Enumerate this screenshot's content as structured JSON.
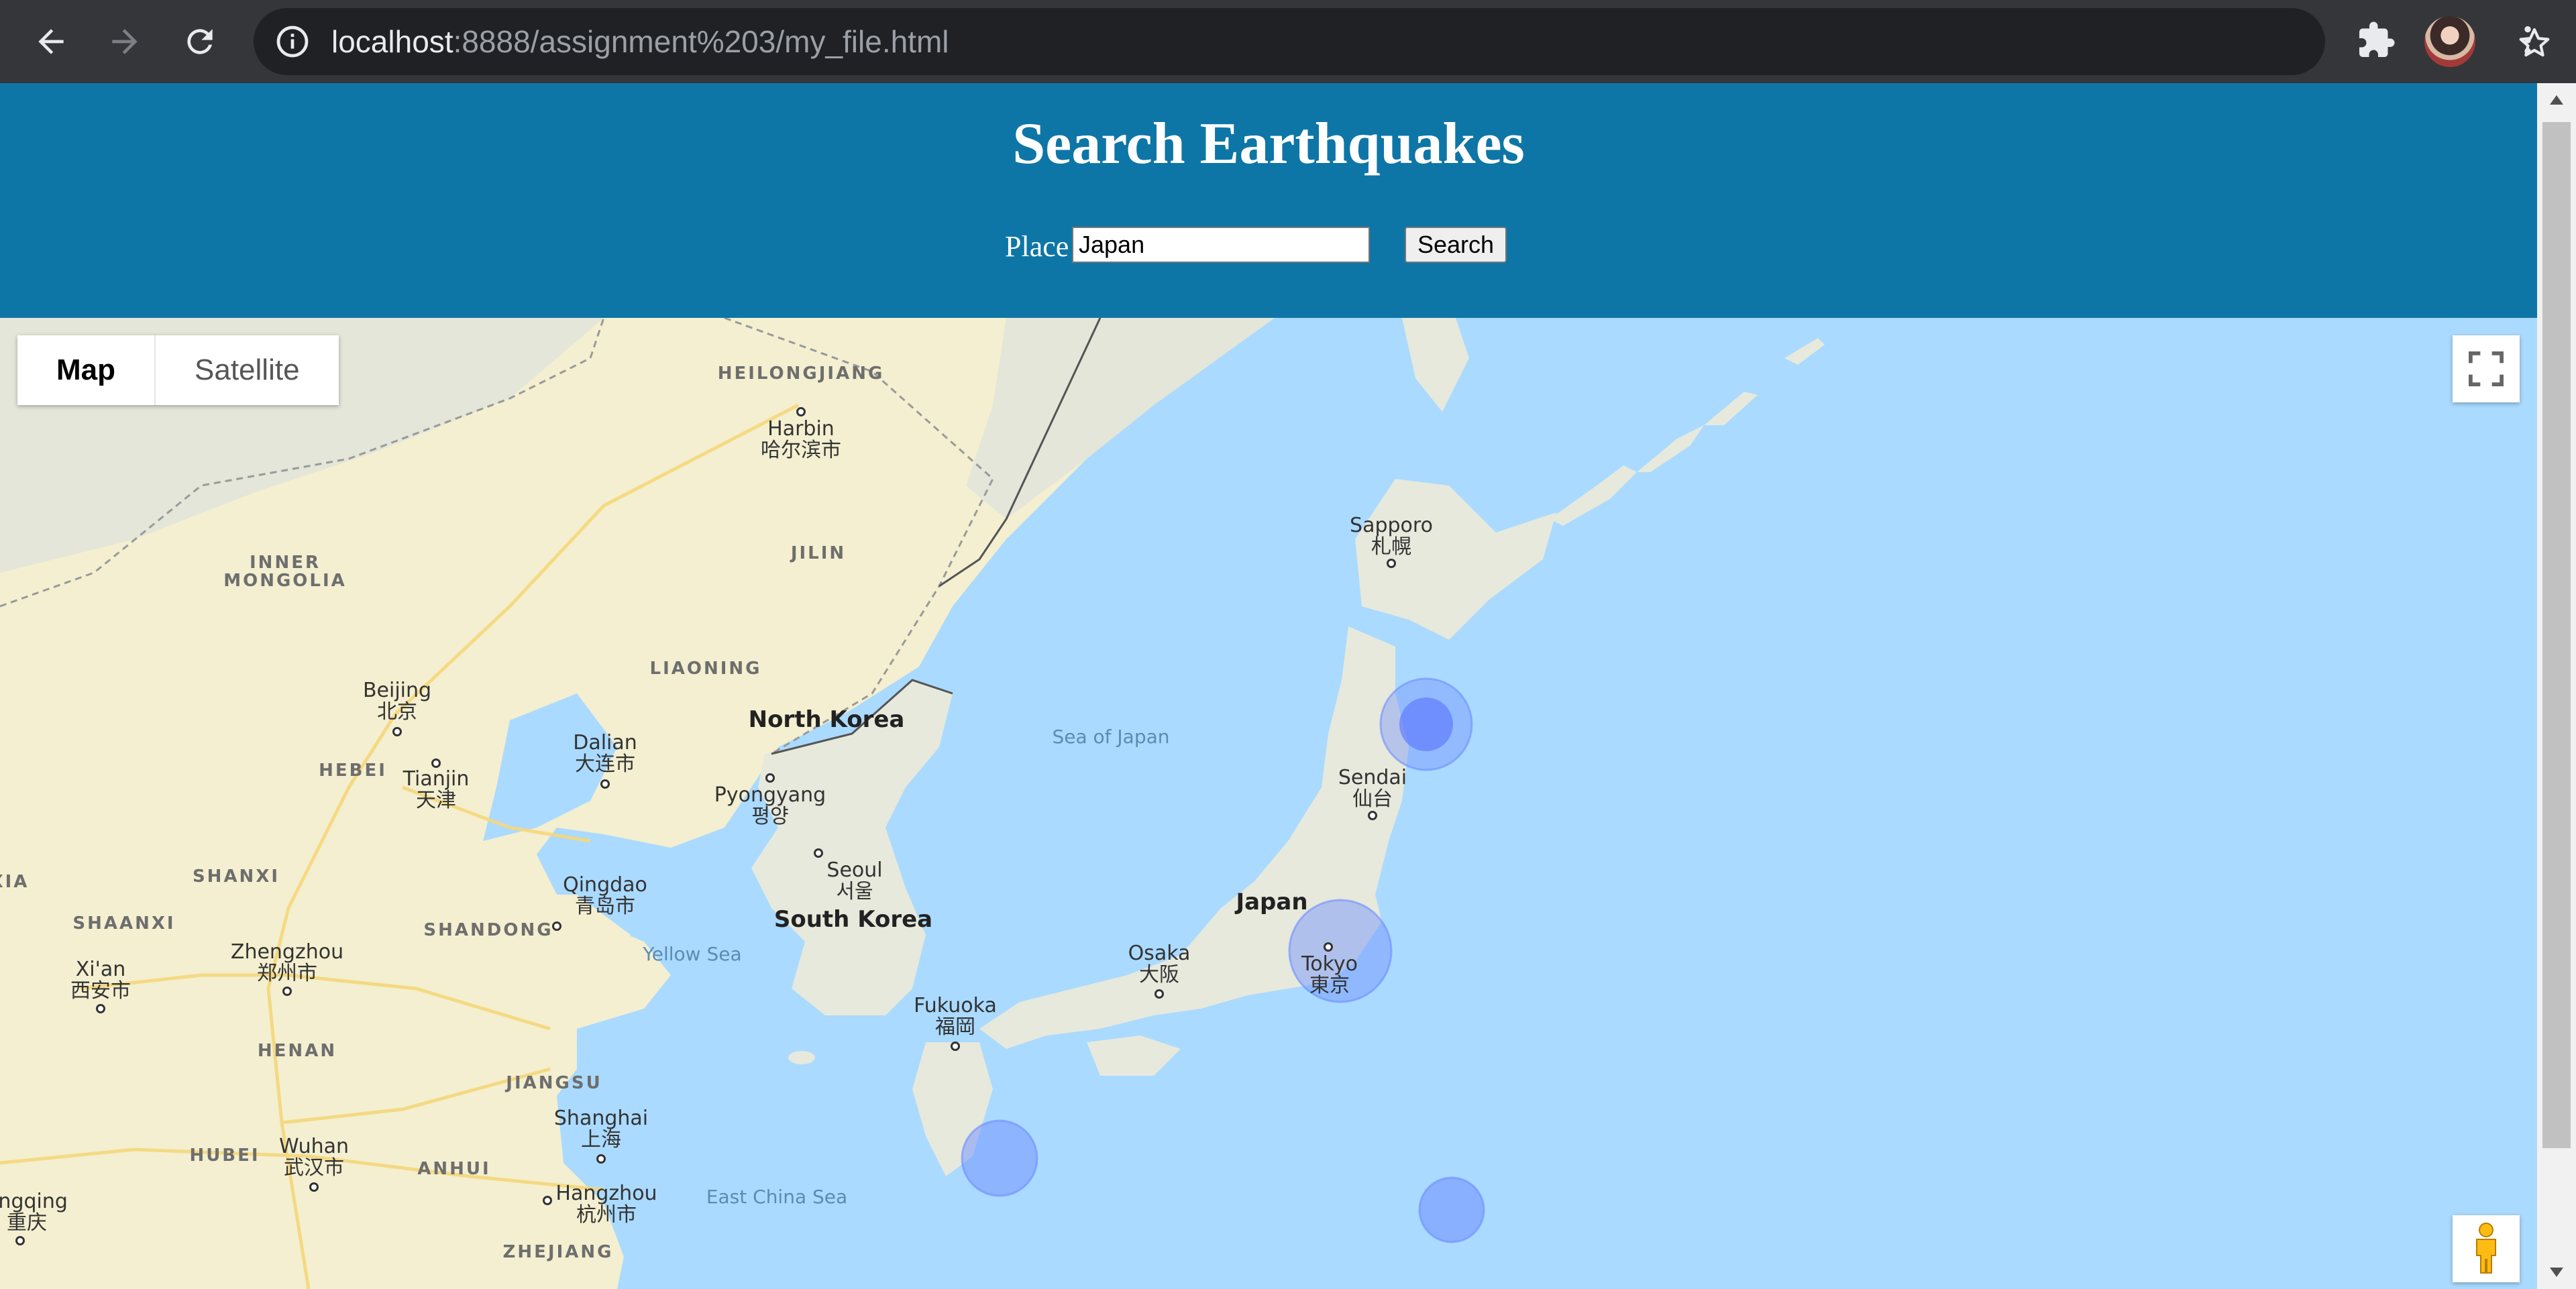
{
  "browser": {
    "url_host": "localhost",
    "url_rest": ":8888/assignment%203/my_file.html"
  },
  "page": {
    "title": "Search Earthquakes",
    "place_label": "Place",
    "place_value": "Japan",
    "search_label": "Search"
  },
  "map": {
    "type_controls": [
      "Map",
      "Satellite"
    ],
    "active_type": "Map",
    "labels": {
      "heilongjiang": "HEILONGJIANG",
      "harbin": "Harbin",
      "harbin_local": "哈尔滨市",
      "jilin": "JILIN",
      "inner_mongolia": "INNER\nMONGOLIA",
      "liaoning": "LIAONING",
      "beijing": "Beijing",
      "beijing_local": "北京",
      "hebei": "HEBEI",
      "tianjin": "Tianjin",
      "tianjin_local": "天津",
      "dalian": "Dalian",
      "dalian_local": "大连市",
      "north_korea": "North Korea",
      "pyongyang": "Pyongyang",
      "pyongyang_local": "평양",
      "seoul": "Seoul",
      "seoul_local": "서울",
      "south_korea": "South Korea",
      "sea_of_japan": "Sea of Japan",
      "sapporo": "Sapporo",
      "sapporo_local": "札幌",
      "sendai": "Sendai",
      "sendai_local": "仙台",
      "japan": "Japan",
      "tokyo": "Tokyo",
      "tokyo_local": "東京",
      "osaka": "Osaka",
      "osaka_local": "大阪",
      "fukuoka": "Fukuoka",
      "fukuoka_local": "福岡",
      "shanxi": "SHANXI",
      "shaanxi": "SHAANXI",
      "xian": "Xi'an",
      "xian_local": "西安市",
      "zhengzhou": "Zhengzhou",
      "zhengzhou_local": "郑州市",
      "shandong": "SHANDONG",
      "qingdao": "Qingdao",
      "qingdao_local": "青岛市",
      "yellow_sea": "Yellow Sea",
      "henan": "HENAN",
      "jiangsu": "JIANGSU",
      "shanghai": "Shanghai",
      "shanghai_local": "上海",
      "hubei": "HUBEI",
      "wuhan": "Wuhan",
      "wuhan_local": "武汉市",
      "anhui": "ANHUI",
      "hangzhou": "Hangzhou",
      "hangzhou_local": "杭州市",
      "east_china_sea": "East China Sea",
      "zhejiang": "ZHEJIANG",
      "chongqing": "ongqing",
      "chongqing_local": "重庆",
      "xia_partial": "XIA"
    },
    "earthquake_markers": 4
  }
}
